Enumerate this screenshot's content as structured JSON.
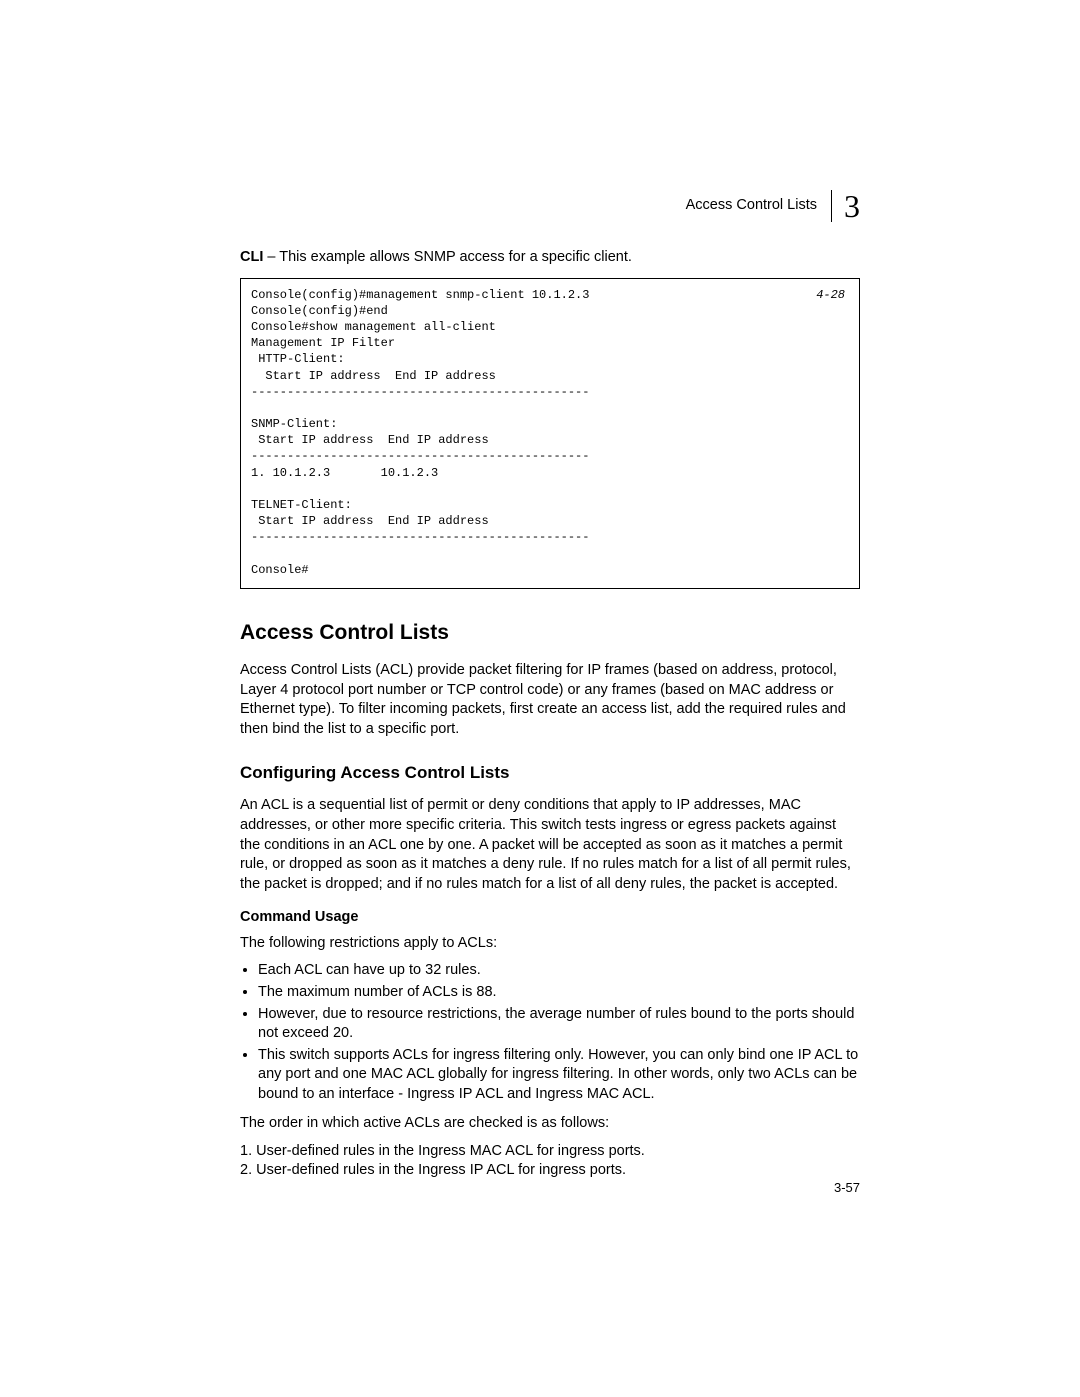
{
  "header": {
    "title": "Access Control Lists",
    "chapter": "3"
  },
  "cli_intro": {
    "prefix": "CLI",
    "rest": " – This example allows SNMP access for a specific client."
  },
  "code": {
    "ref": "4-28",
    "body": "Console(config)#management snmp-client 10.1.2.3\nConsole(config)#end\nConsole#show management all-client\nManagement IP Filter\n HTTP-Client:\n  Start IP address  End IP address\n-----------------------------------------------\n\nSNMP-Client:\n Start IP address  End IP address\n-----------------------------------------------\n1. 10.1.2.3       10.1.2.3\n\nTELNET-Client:\n Start IP address  End IP address\n-----------------------------------------------\n\nConsole#"
  },
  "section_heading": "Access Control Lists",
  "section_para": "Access Control Lists (ACL) provide packet filtering for IP frames (based on address, protocol, Layer 4 protocol port number or TCP control code) or any frames (based on MAC address or Ethernet type). To filter incoming packets, first create an access list, add the required rules and then bind the list to a specific port.",
  "subsection_heading": "Configuring Access Control Lists",
  "subsection_para": "An ACL is a sequential list of permit or deny conditions that apply to IP addresses, MAC addresses, or other more specific criteria. This switch tests ingress or egress packets against the conditions in an ACL one by one. A packet will be accepted as soon as it matches a permit rule, or dropped as soon as it matches a deny rule. If no rules match for a list of all permit rules, the packet is dropped; and if no rules match for a list of all deny rules, the packet is accepted.",
  "command_usage_heading": "Command Usage",
  "restrictions_intro": "The following restrictions apply to ACLs:",
  "bullets": {
    "b0": "Each ACL can have up to 32 rules.",
    "b1": "The maximum number of ACLs is 88.",
    "b2": "However, due to resource restrictions, the average number of rules bound to the ports should not exceed 20.",
    "b3": "This switch supports ACLs for ingress filtering only. However, you can only bind one IP ACL to any port and one MAC ACL globally for ingress filtering. In other words, only two ACLs can be bound to an interface - Ingress IP ACL and Ingress MAC ACL."
  },
  "order_intro": "The order in which active ACLs are checked is as follows:",
  "order": {
    "o0": "1. User-defined rules in the Ingress MAC ACL for ingress ports.",
    "o1": "2. User-defined rules in the Ingress IP ACL for ingress ports."
  },
  "pagenum": "3-57"
}
